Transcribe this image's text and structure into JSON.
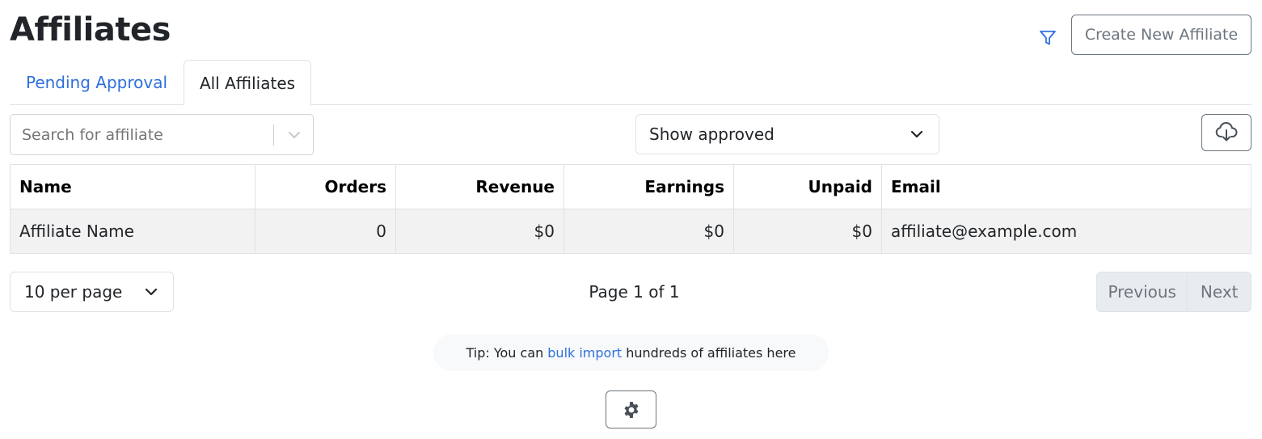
{
  "page": {
    "title": "Affiliates"
  },
  "header": {
    "filter_icon": "filter-icon",
    "create_label": "Create New Affiliate"
  },
  "tabs": [
    {
      "label": "Pending Approval",
      "active": false
    },
    {
      "label": "All Affiliates",
      "active": true
    }
  ],
  "search": {
    "placeholder": "Search for affiliate",
    "value": ""
  },
  "status_filter": {
    "selected": "Show approved"
  },
  "download_icon": "cloud-download-icon",
  "table": {
    "columns": [
      "Name",
      "Orders",
      "Revenue",
      "Earnings",
      "Unpaid",
      "Email"
    ],
    "rows": [
      {
        "name": "Affiliate Name",
        "orders": "0",
        "revenue": "$0",
        "earnings": "$0",
        "unpaid": "$0",
        "email": "affiliate@example.com"
      }
    ]
  },
  "pagination": {
    "per_page": "10 per page",
    "page_info": "Page 1 of 1",
    "previous": "Previous",
    "next": "Next"
  },
  "tip": {
    "prefix": "Tip: You can",
    "link": "bulk import",
    "suffix": "hundreds of affiliates here"
  },
  "settings_icon": "gear-icon",
  "colors": {
    "link": "#2f6fde",
    "muted": "#6c757d",
    "border": "#dee2e6",
    "row_bg": "#f2f2f2"
  }
}
